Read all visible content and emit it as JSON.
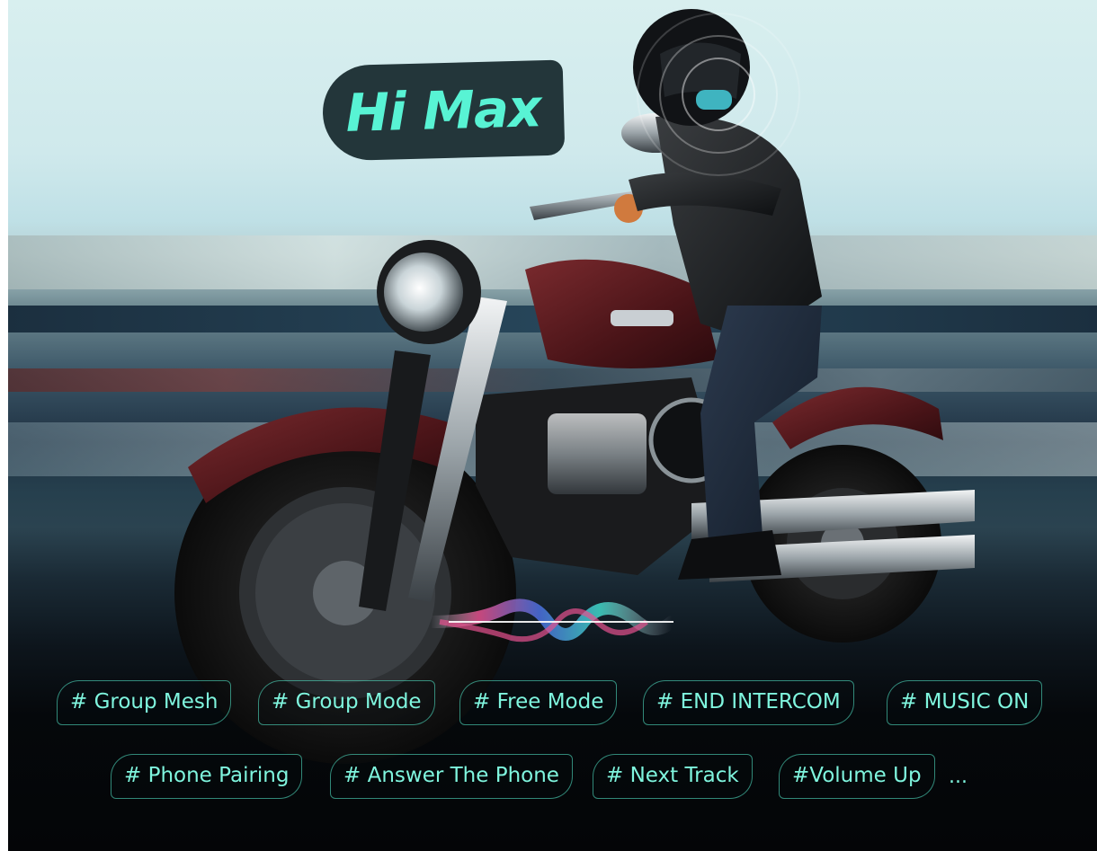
{
  "badge": {
    "text": "Hi Max"
  },
  "voice_wave": {
    "icon": "voice-wave-icon",
    "colors": [
      "#e5518f",
      "#4c6fe0",
      "#3fd7c8",
      "#f6f0ff"
    ]
  },
  "commands": {
    "row1": [
      "# Group Mesh",
      "# Group Mode",
      "# Free Mode",
      "# END INTERCOM",
      "# MUSIC ON"
    ],
    "row2": [
      "# Phone Pairing",
      "# Answer The Phone",
      "# Next Track",
      "#Volume Up"
    ],
    "more": "..."
  },
  "colors": {
    "accent": "#58f3d4",
    "badge_bg": "#23363a",
    "bottom_bg": "#040507"
  }
}
